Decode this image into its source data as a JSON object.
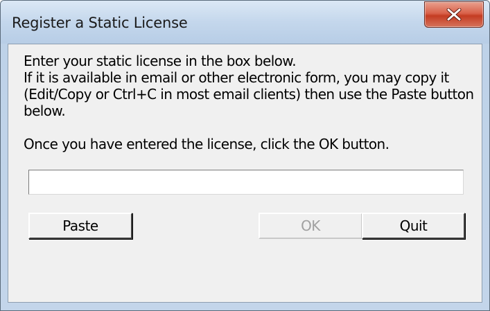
{
  "window": {
    "title": "Register a Static License"
  },
  "icons": {
    "close": "close-icon"
  },
  "instructions": {
    "line1": "Enter your static license in the box below.",
    "line2": "If it is available in email or other electronic form, you may copy it",
    "line3": "(Edit/Copy or Ctrl+C in most email clients) then use the Paste button",
    "line4": "below.",
    "line5": "Once you have entered the license, click the OK button."
  },
  "license_field": {
    "value": "",
    "placeholder": ""
  },
  "buttons": {
    "paste": "Paste",
    "ok": "OK",
    "quit": "Quit"
  },
  "colors": {
    "close_button": "#c43c22",
    "dialog_background": "#f0f0f0",
    "disabled_text": "#a0a0a0"
  }
}
